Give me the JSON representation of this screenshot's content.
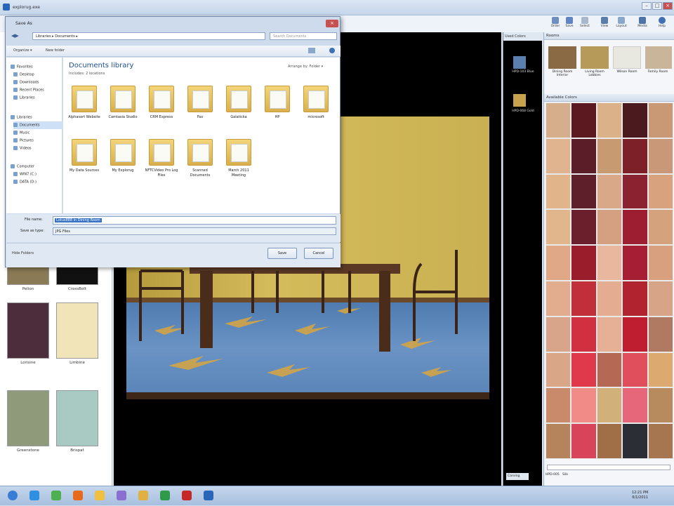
{
  "app": {
    "title": "explorug.exe",
    "ribbon": [
      "Order",
      "Save",
      "Select",
      "View",
      "Layout",
      "Media",
      "Help"
    ]
  },
  "left_panel": {
    "tiles": [
      {
        "label": "Pelion",
        "color": "#8a7a55"
      },
      {
        "label": "CrossBolt",
        "color": "#111111"
      },
      {
        "label": "Lorisine",
        "color": "#4d2d3c"
      },
      {
        "label": "Limbine",
        "color": "#f1e4b9"
      },
      {
        "label": "Greenstone",
        "color": "#8f9a7b"
      },
      {
        "label": "Brispat",
        "color": "#a9c9c3"
      }
    ]
  },
  "items_panel": {
    "header": "Used Colors",
    "items": [
      {
        "label": "HPD-103 Blue",
        "color": "#5a80b0"
      },
      {
        "label": "HPD-068 Gold",
        "color": "#c9a24e"
      }
    ],
    "bottom": "Carving"
  },
  "rooms_panel": {
    "header": "Rooms",
    "rooms": [
      {
        "label": "Dining Room Interior",
        "color": "#8a6a45"
      },
      {
        "label": "Living Room Lobbies",
        "color": "#b59a5a"
      },
      {
        "label": "Wilson Room",
        "color": "#e8e8e0"
      },
      {
        "label": "Family Room",
        "color": "#c8b59a"
      }
    ],
    "colors_header": "Available Colors",
    "footer_code": "HPD-005",
    "footer_name": "Silk",
    "swatches": [
      "#d6ae8c",
      "#5c1a20",
      "#dbb189",
      "#4b1a1e",
      "#c99874",
      "#e0b48f",
      "#5b1d28",
      "#c89a72",
      "#7d2028",
      "#c89878",
      "#e2b48a",
      "#5e1f2a",
      "#d9a888",
      "#8a2230",
      "#d7a27d",
      "#e1b68c",
      "#6b1f2d",
      "#d59f82",
      "#9c1e30",
      "#d5a27e",
      "#e0a887",
      "#9a1d2b",
      "#e8b79d",
      "#a51e33",
      "#d9a07f",
      "#e2ac8e",
      "#c02f3a",
      "#e4ad92",
      "#b0232f",
      "#d7a487",
      "#d9a58a",
      "#d0303f",
      "#e5b096",
      "#be1e2f",
      "#b07a62",
      "#d9a687",
      "#e0394b",
      "#b56854",
      "#e0505c",
      "#dcaa70",
      "#c98a6b",
      "#f08b88",
      "#d2b079",
      "#e7677a",
      "#b88b5e",
      "#b5835c",
      "#d8445a",
      "#a06f48",
      "#2b2f35",
      "#a57650"
    ]
  },
  "dialog": {
    "title": "Save As",
    "address": "Libraries ▸ Documents ▸",
    "search_placeholder": "Search Documents",
    "organize": "Organize ▾",
    "new_folder": "New folder",
    "nav": [
      "Favorites",
      "Desktop",
      "Downloads",
      "Recent Places",
      "Libraries",
      "Libraries",
      "Documents",
      "Music",
      "Pictures",
      "Videos",
      "Computer",
      "WIN7 (C:)",
      "DATA (D:)"
    ],
    "library_title": "Documents library",
    "library_sub": "Includes: 2 locations",
    "arrange_by": "Arrange by: Folder ▾",
    "folders": [
      "Alphasort Website",
      "Camtasia Studio",
      "CRM Express",
      "Fax",
      "Galaticka",
      "HP",
      "microsoft",
      "My Data Sources",
      "My Explorug",
      "NFTCVideo Pro Log Files",
      "Scanned Documents",
      "March 2011 Meeting"
    ],
    "file_name_label": "File name:",
    "file_name_value": "Lotus888 in Dining Room",
    "save_type_label": "Save as type:",
    "save_type_value": "JPG Files",
    "hide_folders": "Hide Folders",
    "save_label": "Save",
    "cancel_label": "Cancel"
  },
  "taskbar": {
    "icons": [
      "start-orb",
      "ie",
      "chrome",
      "firefox",
      "explorer",
      "media",
      "folder",
      "excel",
      "acrobat",
      "explorug"
    ],
    "time": "12:21 PM",
    "date": "6/1/2011"
  }
}
